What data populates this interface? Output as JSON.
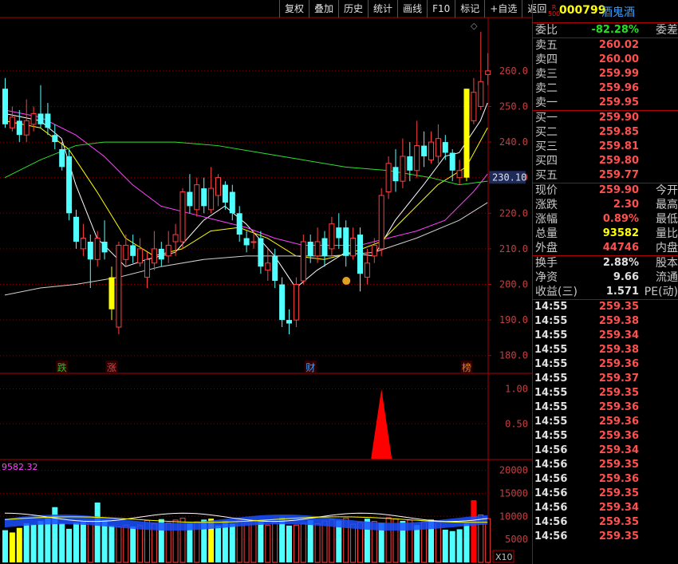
{
  "toolbar": {
    "items": [
      "复权",
      "叠加",
      "历史",
      "统计",
      "画线",
      "F10",
      "标记",
      "+自选",
      "返回"
    ]
  },
  "stock": {
    "badge_top": "R",
    "badge_bottom": "500",
    "code": "000799",
    "name": "酒鬼酒"
  },
  "quote": {
    "weibi_label": "委比",
    "weibi_value": "-82.28%",
    "weicha_label": "委差",
    "asks": [
      {
        "label": "卖五",
        "price": "260.02"
      },
      {
        "label": "卖四",
        "price": "260.00"
      },
      {
        "label": "卖三",
        "price": "259.99"
      },
      {
        "label": "卖二",
        "price": "259.96"
      },
      {
        "label": "卖一",
        "price": "259.95"
      }
    ],
    "bids": [
      {
        "label": "买一",
        "price": "259.90"
      },
      {
        "label": "买二",
        "price": "259.85"
      },
      {
        "label": "买三",
        "price": "259.81"
      },
      {
        "label": "买四",
        "price": "259.80"
      },
      {
        "label": "买五",
        "price": "259.77"
      }
    ],
    "stats": [
      {
        "label": "现价",
        "value": "259.90",
        "right": "今开",
        "color": "#ff5050"
      },
      {
        "label": "涨跌",
        "value": "2.30",
        "right": "最高",
        "color": "#ff5050"
      },
      {
        "label": "涨幅",
        "value": "0.89%",
        "right": "最低",
        "color": "#ff5050"
      },
      {
        "label": "总量",
        "value": "93582",
        "right": "量比",
        "color": "#ffff00"
      },
      {
        "label": "外盘",
        "value": "44746",
        "right": "内盘",
        "color": "#ff5050"
      }
    ],
    "fin": [
      {
        "label": "换手",
        "value": "2.88%",
        "right": "股本"
      },
      {
        "label": "净资",
        "value": "9.66",
        "right": "流通"
      },
      {
        "label": "收益(三)",
        "value": "1.571",
        "right": "PE(动)"
      }
    ]
  },
  "ticks": [
    {
      "time": "14:55",
      "price": "259.35"
    },
    {
      "time": "14:55",
      "price": "259.38"
    },
    {
      "time": "14:55",
      "price": "259.34"
    },
    {
      "time": "14:55",
      "price": "259.38"
    },
    {
      "time": "14:55",
      "price": "259.36"
    },
    {
      "time": "14:55",
      "price": "259.37"
    },
    {
      "time": "14:55",
      "price": "259.35"
    },
    {
      "time": "14:55",
      "price": "259.36"
    },
    {
      "time": "14:55",
      "price": "259.36"
    },
    {
      "time": "14:55",
      "price": "259.36"
    },
    {
      "time": "14:56",
      "price": "259.34"
    },
    {
      "time": "14:56",
      "price": "259.35"
    },
    {
      "time": "14:56",
      "price": "259.36"
    },
    {
      "time": "14:56",
      "price": "259.35"
    },
    {
      "time": "14:56",
      "price": "259.34"
    },
    {
      "time": "14:56",
      "price": "259.35"
    },
    {
      "time": "14:56",
      "price": "259.35"
    }
  ],
  "chart_data": [
    {
      "type": "candlestick",
      "y_ticks": [
        "260.0",
        "250.0",
        "240.0",
        "230.0",
        "220.0",
        "210.0",
        "200.0",
        "190.0",
        "180.0"
      ],
      "ylim": [
        175,
        275
      ],
      "current_price_label": "230.10",
      "current_price": 230.1,
      "event_markers": [
        {
          "label": "跌",
          "index": 8,
          "color": "#20c020"
        },
        {
          "label": "涨",
          "index": 15,
          "color": "#e04040"
        },
        {
          "label": "财",
          "index": 43,
          "color": "#3aa0ff"
        },
        {
          "label": "榜",
          "index": 65,
          "color": "#e08020"
        }
      ],
      "candles": [
        {
          "o": 255,
          "c": 245,
          "h": 258,
          "l": 244
        },
        {
          "o": 244,
          "c": 247,
          "h": 250,
          "l": 243
        },
        {
          "o": 246,
          "c": 242,
          "h": 249,
          "l": 240
        },
        {
          "o": 242,
          "c": 246,
          "h": 252,
          "l": 240
        },
        {
          "o": 245,
          "c": 248,
          "h": 250,
          "l": 243
        },
        {
          "o": 248,
          "c": 245,
          "h": 256,
          "l": 244
        },
        {
          "o": 248,
          "c": 244,
          "h": 251,
          "l": 242
        },
        {
          "o": 242,
          "c": 240,
          "h": 245,
          "l": 238
        },
        {
          "o": 238,
          "c": 233,
          "h": 240,
          "l": 232
        },
        {
          "o": 236,
          "c": 220,
          "h": 238,
          "l": 218
        },
        {
          "o": 219,
          "c": 212,
          "h": 221,
          "l": 210
        },
        {
          "o": 210,
          "c": 213,
          "h": 217,
          "l": 208
        },
        {
          "o": 212,
          "c": 207,
          "h": 214,
          "l": 199
        },
        {
          "o": 207,
          "c": 213,
          "h": 215,
          "l": 205
        },
        {
          "o": 212,
          "c": 209,
          "h": 218,
          "l": 207
        },
        {
          "o": 202,
          "c": 193,
          "h": 205,
          "l": 190
        },
        {
          "o": 188,
          "c": 211,
          "h": 212,
          "l": 186
        },
        {
          "o": 207,
          "c": 211,
          "h": 214,
          "l": 205
        },
        {
          "o": 211,
          "c": 208,
          "h": 214,
          "l": 206
        },
        {
          "o": 206,
          "c": 210,
          "h": 213,
          "l": 205
        },
        {
          "o": 202,
          "c": 207,
          "h": 209,
          "l": 199
        },
        {
          "o": 206,
          "c": 210,
          "h": 215,
          "l": 204
        },
        {
          "o": 210,
          "c": 207,
          "h": 212,
          "l": 205
        },
        {
          "o": 208,
          "c": 211,
          "h": 215,
          "l": 206
        },
        {
          "o": 212,
          "c": 214,
          "h": 217,
          "l": 208
        },
        {
          "o": 212,
          "c": 226,
          "h": 227,
          "l": 210
        },
        {
          "o": 226,
          "c": 222,
          "h": 231,
          "l": 220
        },
        {
          "o": 221,
          "c": 228,
          "h": 230,
          "l": 219
        },
        {
          "o": 227,
          "c": 222,
          "h": 230,
          "l": 220
        },
        {
          "o": 221,
          "c": 227,
          "h": 233,
          "l": 220
        },
        {
          "o": 225,
          "c": 230,
          "h": 231,
          "l": 222
        },
        {
          "o": 228,
          "c": 223,
          "h": 229,
          "l": 221
        },
        {
          "o": 226,
          "c": 220,
          "h": 228,
          "l": 218
        },
        {
          "o": 220,
          "c": 214,
          "h": 222,
          "l": 212
        },
        {
          "o": 213,
          "c": 211,
          "h": 215,
          "l": 209
        },
        {
          "o": 212,
          "c": 212,
          "h": 215,
          "l": 210
        },
        {
          "o": 213,
          "c": 205,
          "h": 215,
          "l": 203
        },
        {
          "o": 204,
          "c": 206,
          "h": 210,
          "l": 201
        },
        {
          "o": 208,
          "c": 201,
          "h": 210,
          "l": 199
        },
        {
          "o": 200,
          "c": 190,
          "h": 202,
          "l": 188
        },
        {
          "o": 190,
          "c": 189,
          "h": 193,
          "l": 186
        },
        {
          "o": 190,
          "c": 200,
          "h": 202,
          "l": 188
        },
        {
          "o": 201,
          "c": 212,
          "h": 214,
          "l": 200
        },
        {
          "o": 212,
          "c": 208,
          "h": 214,
          "l": 206
        },
        {
          "o": 208,
          "c": 212,
          "h": 216,
          "l": 206
        },
        {
          "o": 213,
          "c": 208,
          "h": 215,
          "l": 205
        },
        {
          "o": 210,
          "c": 217,
          "h": 219,
          "l": 208
        },
        {
          "o": 216,
          "c": 213,
          "h": 220,
          "l": 210
        },
        {
          "o": 216,
          "c": 208,
          "h": 218,
          "l": 205
        },
        {
          "o": 208,
          "c": 213,
          "h": 216,
          "l": 207
        },
        {
          "o": 214,
          "c": 203,
          "h": 216,
          "l": 198
        },
        {
          "o": 202,
          "c": 206,
          "h": 210,
          "l": 200
        },
        {
          "o": 208,
          "c": 211,
          "h": 213,
          "l": 206
        },
        {
          "o": 210,
          "c": 225,
          "h": 227,
          "l": 208
        },
        {
          "o": 226,
          "c": 234,
          "h": 236,
          "l": 224
        },
        {
          "o": 233,
          "c": 229,
          "h": 238,
          "l": 226
        },
        {
          "o": 229,
          "c": 236,
          "h": 241,
          "l": 227
        },
        {
          "o": 236,
          "c": 232,
          "h": 240,
          "l": 229
        },
        {
          "o": 232,
          "c": 239,
          "h": 246,
          "l": 230
        },
        {
          "o": 239,
          "c": 236,
          "h": 243,
          "l": 233
        },
        {
          "o": 235,
          "c": 240,
          "h": 243,
          "l": 234
        },
        {
          "o": 236,
          "c": 241,
          "h": 245,
          "l": 234
        },
        {
          "o": 240,
          "c": 237,
          "h": 242,
          "l": 235
        },
        {
          "o": 237,
          "c": 232,
          "h": 238,
          "l": 229
        },
        {
          "o": 230,
          "c": 232,
          "h": 235,
          "l": 228
        },
        {
          "o": 230,
          "c": 255,
          "h": 255,
          "l": 229
        },
        {
          "o": 246,
          "c": 254,
          "h": 258,
          "l": 245
        },
        {
          "o": 250,
          "c": 257,
          "h": 271,
          "l": 249
        },
        {
          "o": 259,
          "c": 260,
          "h": 265,
          "l": 256
        }
      ],
      "ma": [
        {
          "name": "MA5",
          "color": "#ffffff",
          "points": [
            [
              0,
              248
            ],
            [
              5,
              246
            ],
            [
              8,
              241
            ],
            [
              10,
              228
            ],
            [
              13,
              213
            ],
            [
              17,
              205
            ],
            [
              20,
              207
            ],
            [
              24,
              209
            ],
            [
              28,
              218
            ],
            [
              31,
              222
            ],
            [
              34,
              217
            ],
            [
              38,
              208
            ],
            [
              41,
              199
            ],
            [
              44,
              204
            ],
            [
              48,
              209
            ],
            [
              52,
              208
            ],
            [
              55,
              218
            ],
            [
              59,
              228
            ],
            [
              62,
              236
            ],
            [
              64,
              237
            ],
            [
              67,
              246
            ],
            [
              68,
              251
            ]
          ]
        },
        {
          "name": "MA10",
          "color": "#ffff00",
          "points": [
            [
              0,
              246
            ],
            [
              5,
              244
            ],
            [
              9,
              238
            ],
            [
              13,
              226
            ],
            [
              17,
              213
            ],
            [
              21,
              208
            ],
            [
              25,
              210
            ],
            [
              29,
              215
            ],
            [
              33,
              216
            ],
            [
              37,
              213
            ],
            [
              41,
              208
            ],
            [
              45,
              207
            ],
            [
              49,
              209
            ],
            [
              53,
              212
            ],
            [
              57,
              220
            ],
            [
              61,
              228
            ],
            [
              65,
              233
            ],
            [
              68,
              244
            ]
          ]
        },
        {
          "name": "MA20",
          "color": "#ff40ff",
          "points": [
            [
              0,
              249
            ],
            [
              5,
              247
            ],
            [
              10,
              242
            ],
            [
              14,
              236
            ],
            [
              18,
              228
            ],
            [
              22,
              222
            ],
            [
              26,
              220
            ],
            [
              30,
              218
            ],
            [
              34,
              216
            ],
            [
              38,
              213
            ],
            [
              42,
              211
            ],
            [
              46,
              211
            ],
            [
              50,
              211
            ],
            [
              54,
              213
            ],
            [
              58,
              215
            ],
            [
              62,
              218
            ],
            [
              66,
              226
            ],
            [
              68,
              231
            ]
          ]
        },
        {
          "name": "MA60",
          "color": "#30e030",
          "points": [
            [
              0,
              230
            ],
            [
              5,
              235
            ],
            [
              10,
              239
            ],
            [
              14,
              240
            ],
            [
              18,
              240
            ],
            [
              24,
              240
            ],
            [
              30,
              239
            ],
            [
              36,
              237
            ],
            [
              42,
              235
            ],
            [
              48,
              233
            ],
            [
              54,
              232
            ],
            [
              60,
              230
            ],
            [
              64,
              228
            ],
            [
              68,
              229
            ]
          ]
        },
        {
          "name": "MA120",
          "color": "#d0d0d0",
          "points": [
            [
              0,
              197
            ],
            [
              5,
              199
            ],
            [
              10,
              200
            ],
            [
              16,
              202
            ],
            [
              22,
              205
            ],
            [
              28,
              207
            ],
            [
              34,
              208
            ],
            [
              40,
              208
            ],
            [
              46,
              208
            ],
            [
              52,
              209
            ],
            [
              58,
              213
            ],
            [
              64,
              218
            ],
            [
              68,
              223
            ]
          ]
        }
      ]
    },
    {
      "type": "indicator",
      "y_ticks": [
        "1.00",
        "0.50"
      ],
      "ylim": [
        0,
        1.2
      ],
      "spike": {
        "index": 53,
        "value": 1.0
      }
    },
    {
      "type": "bar",
      "label": "9582.32",
      "unit_label": "X10",
      "y_ticks": [
        "20000",
        "15000",
        "10000",
        "5000"
      ],
      "ylim": [
        0,
        22000
      ],
      "volumes": [
        7000,
        6500,
        7500,
        8500,
        8200,
        9000,
        10000,
        12000,
        8500,
        7300,
        8600,
        8800,
        9000,
        13000,
        9200,
        8000,
        7700,
        8100,
        7800,
        8000,
        9100,
        8400,
        9400,
        8600,
        9200,
        9600,
        8500,
        8800,
        9300,
        9500,
        8000,
        9000,
        8400,
        9100,
        8600,
        9300,
        8800,
        8100,
        8700,
        9800,
        8000,
        8100,
        8500,
        9200,
        8400,
        9000,
        9300,
        9100,
        9600,
        8300,
        8700,
        9500,
        8900,
        8600,
        9700,
        9400,
        9000,
        9200,
        8100,
        8800,
        9300,
        8700,
        7100,
        6800,
        7200,
        8500,
        13500,
        10300,
        9500
      ],
      "colors": [
        "#50ffff",
        "#ffff00",
        "#ffff00",
        "#50ffff",
        "#50ffff",
        "#50ffff",
        "#50ffff",
        "#50ffff",
        "#50ffff",
        "#50ffff",
        "#50ffff",
        "#50ffff",
        "#ff4040",
        "#50ffff",
        "#50ffff",
        "#50ffff",
        "#ff4040",
        "#ff4040",
        "#50ffff",
        "#ff4040",
        "#ff4040",
        "#ff4040",
        "#50ffff",
        "#ff4040",
        "#ff4040",
        "#ff4040",
        "#50ffff",
        "#ff4040",
        "#50ffff",
        "#ffff00",
        "#50ffff",
        "#50ffff",
        "#50ffff",
        "#ff4040",
        "#ff4040",
        "#ff4040",
        "#50ffff",
        "#ff4040",
        "#ff4040",
        "#50ffff",
        "#50ffff",
        "#ff4040",
        "#ff4040",
        "#50ffff",
        "#ff4040",
        "#ff4040",
        "#ff4040",
        "#50ffff",
        "#ff4040",
        "#ff4040",
        "#ff4040",
        "#50ffff",
        "#ff4040",
        "#50ffff",
        "#ff4040",
        "#ff4040",
        "#50ffff",
        "#ff4040",
        "#50ffff",
        "#ff4040",
        "#50ffff",
        "#ff4040",
        "#50ffff",
        "#50ffff",
        "#50ffff",
        "#50ffff",
        "#ff0000",
        "#ff4040",
        "#ff4040"
      ]
    }
  ]
}
